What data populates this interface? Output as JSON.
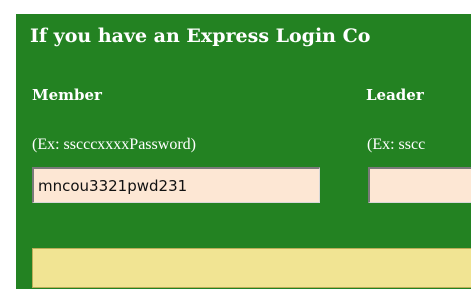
{
  "header": {
    "title": "If you have an Express Login Co"
  },
  "member": {
    "label": "Member",
    "hint": "(Ex: sscccxxxxPassword)",
    "value": "mncou3321pwd231"
  },
  "leader": {
    "label": "Leader",
    "hint": "(Ex: sscc",
    "value": ""
  },
  "submit": {
    "label": ""
  },
  "colors": {
    "panel_bg": "#238222",
    "input_bg": "#fde7d4",
    "submit_bg": "#f1e493"
  }
}
